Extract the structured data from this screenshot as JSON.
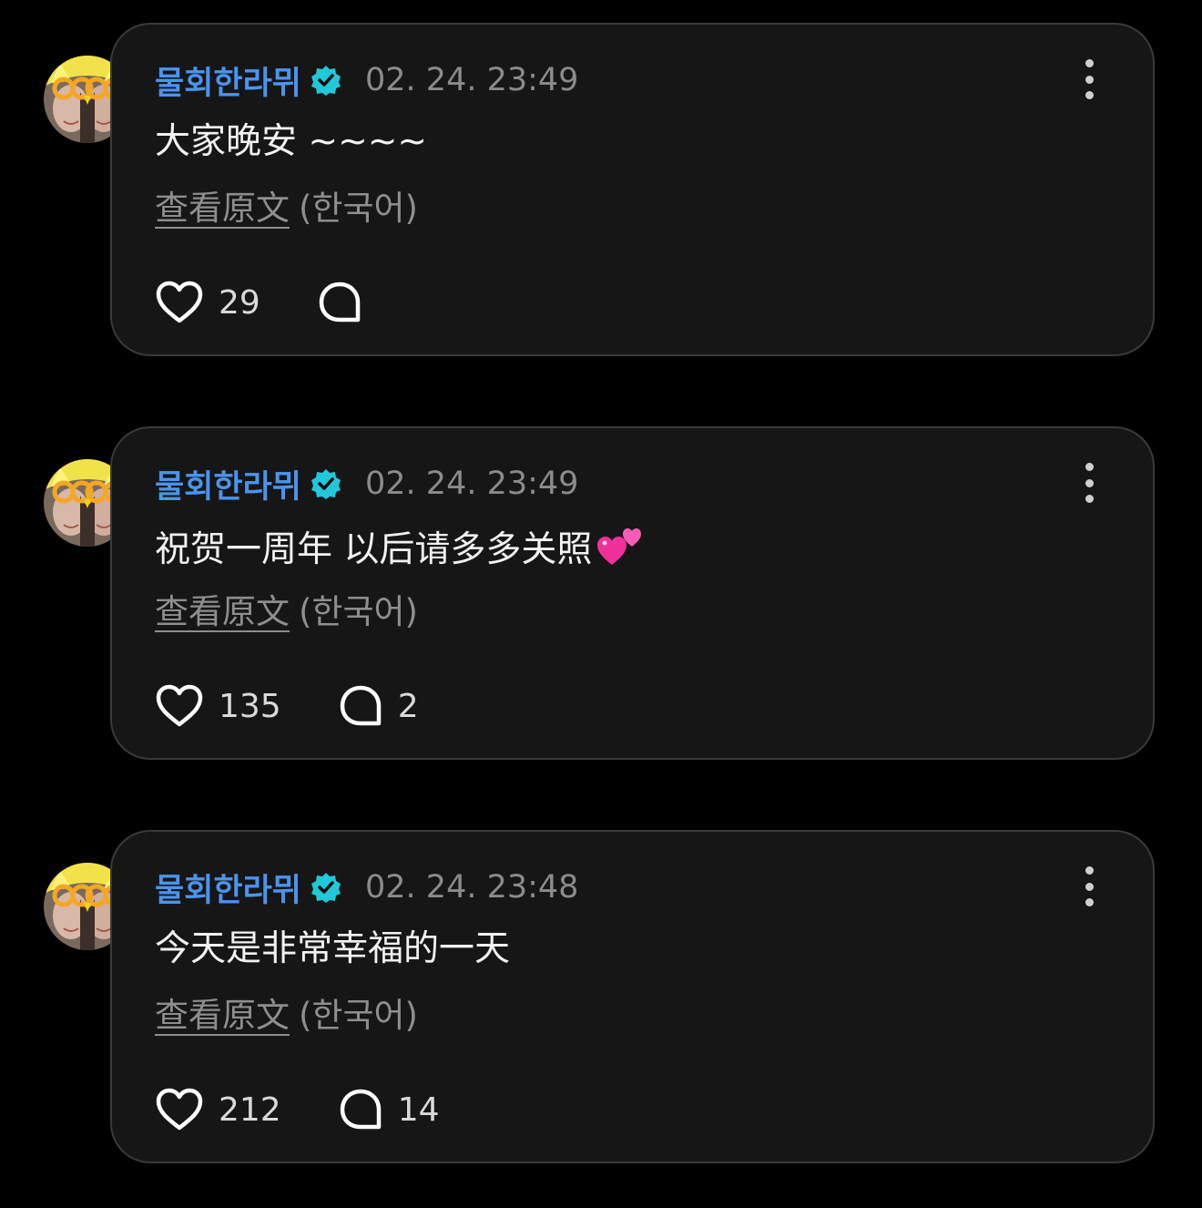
{
  "colors": {
    "background": "#000000",
    "card": "#161616",
    "card_border": "#3a3a3a",
    "username": "#4a94ee",
    "verified_badge": "#21c8d9",
    "muted_text": "#8e8e8e"
  },
  "posts": [
    {
      "author": "물회한라뮈",
      "verified_icon": "verified-badge-icon",
      "timestamp": "02. 24. 23:49",
      "message": "大家晚安 ~~~~",
      "emoji": "",
      "translate_link": "查看原文",
      "translate_lang": "(한국어)",
      "likes": "29",
      "replies": ""
    },
    {
      "author": "물회한라뮈",
      "verified_icon": "verified-badge-icon",
      "timestamp": "02. 24. 23:49",
      "message": "祝贺一周年 以后请多多关照",
      "emoji": "two-hearts-emoji",
      "translate_link": "查看原文",
      "translate_lang": "(한국어)",
      "likes": "135",
      "replies": "2"
    },
    {
      "author": "물회한라뮈",
      "verified_icon": "verified-badge-icon",
      "timestamp": "02. 24. 23:48",
      "message": "今天是非常幸福的一天",
      "emoji": "",
      "translate_link": "查看原文",
      "translate_lang": "(한국어)",
      "likes": "212",
      "replies": "14"
    }
  ]
}
